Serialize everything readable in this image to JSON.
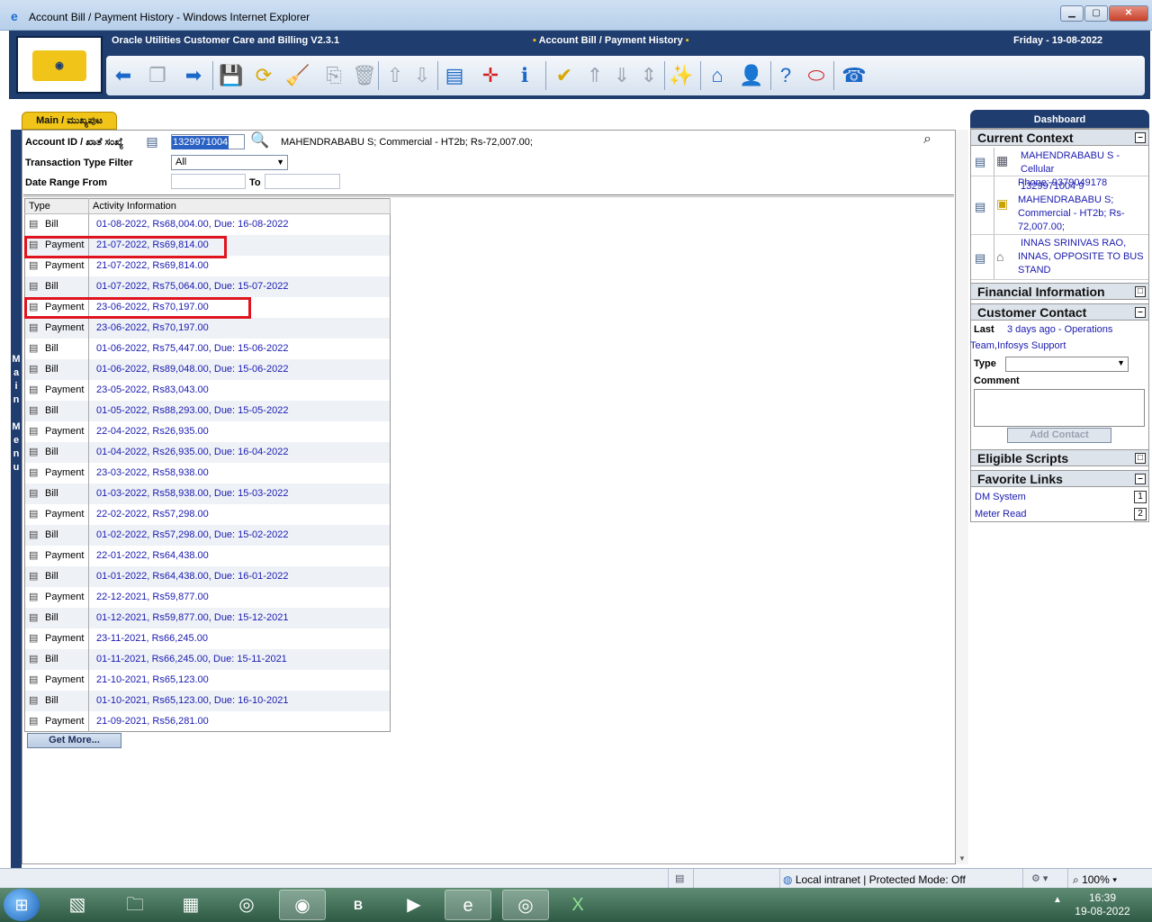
{
  "window": {
    "title": "Account Bill / Payment History - Windows Internet Explorer"
  },
  "app": {
    "name": "Oracle Utilities Customer Care and Billing V2.3.1",
    "page": "Account Bill / Payment History",
    "date": "Friday - 19-08-2022"
  },
  "main_tab": "Main / ಮುಖ್ಯಪುಟ",
  "side_menu": [
    "M",
    "a",
    "i",
    "n",
    "",
    "M",
    "e",
    "n",
    "u"
  ],
  "form": {
    "account_label": "Account ID / ಖಾತೆ ಸಂಖ್ಯೆ",
    "account_value": "1329971004",
    "account_info": "MAHENDRABABU S; Commercial - HT2b; Rs-72,007.00;",
    "filter_label": "Transaction Type Filter",
    "filter_value": "All",
    "date_from_label": "Date Range From",
    "date_to_label": "To"
  },
  "grid": {
    "headers": {
      "type": "Type",
      "info": "Activity Information"
    },
    "rows": [
      {
        "type": "Bill",
        "info": "01-08-2022, Rs68,004.00, Due: 16-08-2022"
      },
      {
        "type": "Payment",
        "info": "21-07-2022, Rs69,814.00"
      },
      {
        "type": "Payment",
        "info": "21-07-2022, Rs69,814.00"
      },
      {
        "type": "Bill",
        "info": "01-07-2022, Rs75,064.00, Due: 15-07-2022"
      },
      {
        "type": "Payment",
        "info": "23-06-2022, Rs70,197.00"
      },
      {
        "type": "Payment",
        "info": "23-06-2022, Rs70,197.00"
      },
      {
        "type": "Bill",
        "info": "01-06-2022, Rs75,447.00, Due: 15-06-2022"
      },
      {
        "type": "Bill",
        "info": "01-06-2022, Rs89,048.00, Due: 15-06-2022"
      },
      {
        "type": "Payment",
        "info": "23-05-2022, Rs83,043.00"
      },
      {
        "type": "Bill",
        "info": "01-05-2022, Rs88,293.00, Due: 15-05-2022"
      },
      {
        "type": "Payment",
        "info": "22-04-2022, Rs26,935.00"
      },
      {
        "type": "Bill",
        "info": "01-04-2022, Rs26,935.00, Due: 16-04-2022"
      },
      {
        "type": "Payment",
        "info": "23-03-2022, Rs58,938.00"
      },
      {
        "type": "Bill",
        "info": "01-03-2022, Rs58,938.00, Due: 15-03-2022"
      },
      {
        "type": "Payment",
        "info": "22-02-2022, Rs57,298.00"
      },
      {
        "type": "Bill",
        "info": "01-02-2022, Rs57,298.00, Due: 15-02-2022"
      },
      {
        "type": "Payment",
        "info": "22-01-2022, Rs64,438.00"
      },
      {
        "type": "Bill",
        "info": "01-01-2022, Rs64,438.00, Due: 16-01-2022"
      },
      {
        "type": "Payment",
        "info": "22-12-2021, Rs59,877.00"
      },
      {
        "type": "Bill",
        "info": "01-12-2021, Rs59,877.00, Due: 15-12-2021"
      },
      {
        "type": "Payment",
        "info": "23-11-2021, Rs66,245.00"
      },
      {
        "type": "Bill",
        "info": "01-11-2021, Rs66,245.00, Due: 15-11-2021"
      },
      {
        "type": "Payment",
        "info": "21-10-2021, Rs65,123.00"
      },
      {
        "type": "Bill",
        "info": "01-10-2021, Rs65,123.00, Due: 16-10-2021"
      },
      {
        "type": "Payment",
        "info": "21-09-2021, Rs56,281.00"
      }
    ],
    "get_more": "Get More..."
  },
  "dashboard": {
    "title": "Dashboard",
    "current_context": {
      "title": "Current Context",
      "items": [
        [
          "MAHENDRABABU S - Cellular",
          "Phone: 9379049178"
        ],
        [
          "1329971004 9",
          "MAHENDRABABU S;",
          "Commercial - HT2b; Rs-",
          "72,007.00;"
        ],
        [
          "INNAS SRINIVAS RAO,",
          "INNAS, OPPOSITE TO BUS",
          "STAND"
        ]
      ]
    },
    "financial_information": "Financial Information",
    "customer_contact": {
      "title": "Customer Contact",
      "last_label": "Last",
      "last_value": "3 days ago - Operations",
      "last_value2": "Team,Infosys Support",
      "type_label": "Type",
      "comment_label": "Comment",
      "add_button": "Add Contact"
    },
    "eligible_scripts": "Eligible Scripts",
    "favorite_links": {
      "title": "Favorite Links",
      "links": [
        {
          "label": "DM System",
          "key": "1"
        },
        {
          "label": "Meter Read",
          "key": "2"
        }
      ]
    }
  },
  "statusbar": {
    "zone": "Local intranet | Protected Mode: Off",
    "zoom": "100%"
  },
  "taskbar": {
    "b_label": "B",
    "time": "16:39",
    "date": "19-08-2022"
  }
}
